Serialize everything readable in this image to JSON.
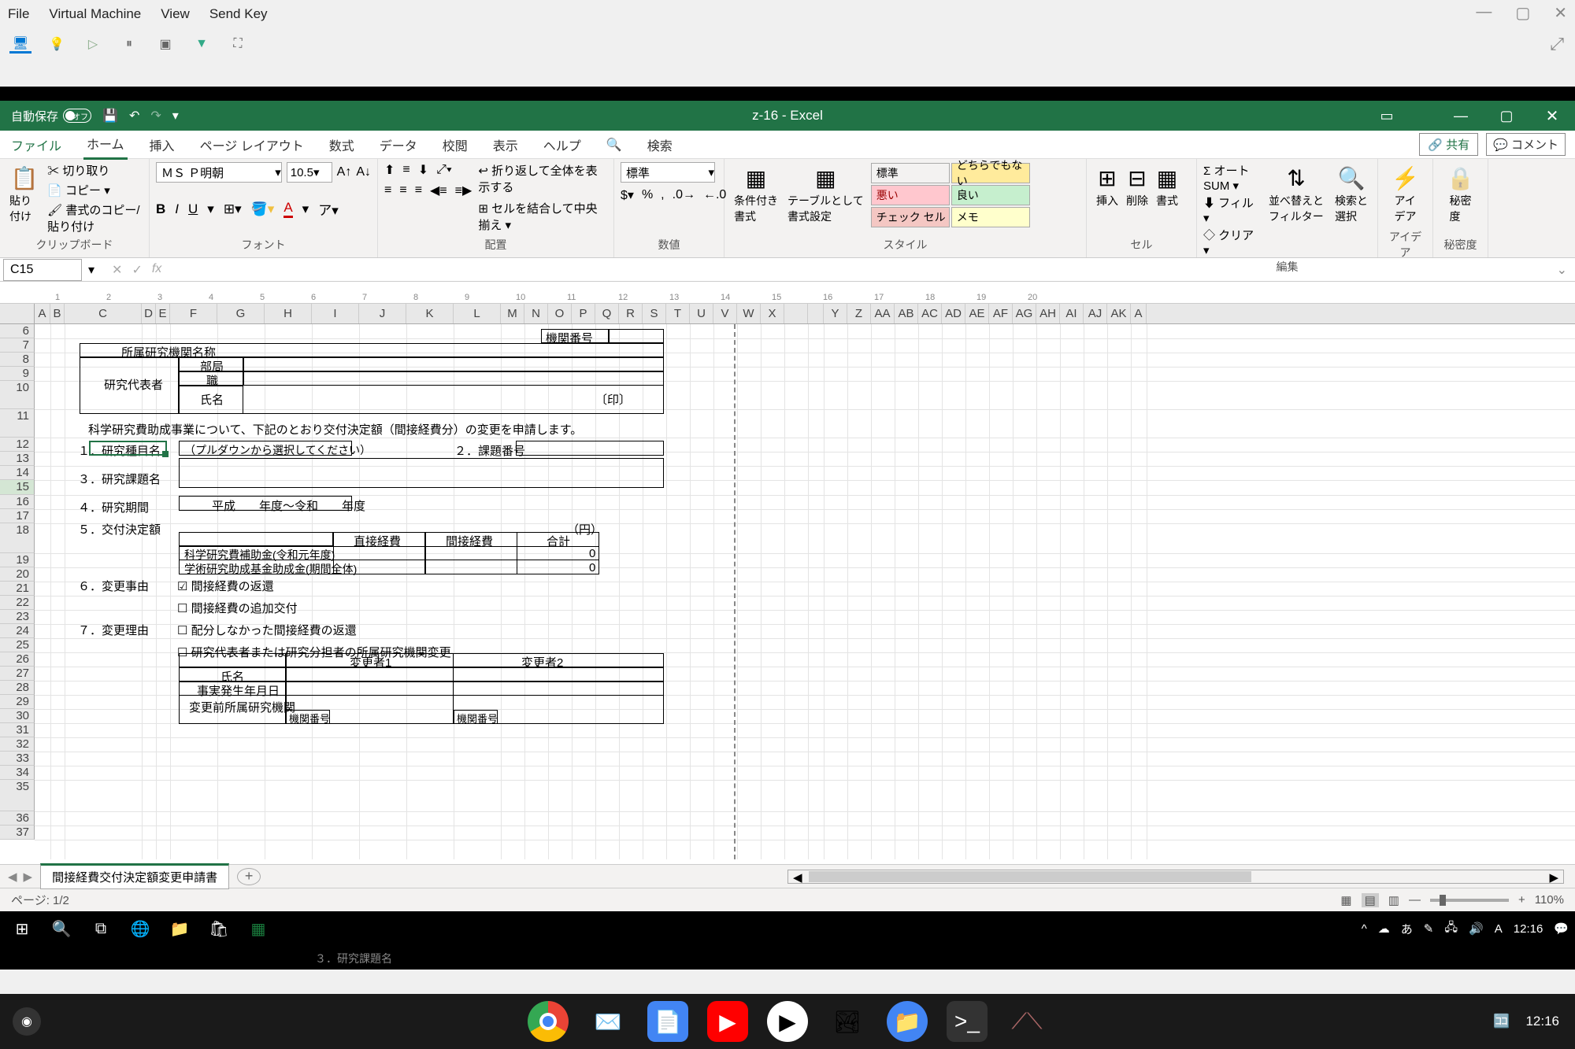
{
  "vm": {
    "menu": [
      "File",
      "Virtual Machine",
      "View",
      "Send Key"
    ]
  },
  "excel": {
    "autosave_label": "自動保存",
    "autosave_state": "オフ",
    "title": "z-16  -  Excel",
    "share": "共有",
    "comment": "コメント",
    "tabs": {
      "file": "ファイル",
      "home": "ホーム",
      "insert": "挿入",
      "page": "ページ レイアウト",
      "formula": "数式",
      "data": "データ",
      "review": "校閲",
      "view": "表示",
      "help": "ヘルプ",
      "search_icon": "",
      "search": "検索"
    },
    "ribbon": {
      "clipboard": {
        "paste": "貼り付け",
        "cut": "切り取り",
        "copy": "コピー",
        "format_painter": "書式のコピー/貼り付け",
        "label": "クリップボード"
      },
      "font": {
        "name": "ＭＳ Ｐ明朝",
        "size": "10.5",
        "label": "フォント"
      },
      "align": {
        "wrap": "折り返して全体を表示する",
        "merge": "セルを結合して中央揃え",
        "label": "配置"
      },
      "number": {
        "format": "標準",
        "label": "数値"
      },
      "styles": {
        "cond": "条件付き\n書式",
        "table": "テーブルとして\n書式設定",
        "s1": "標準",
        "s2": "どちらでもない",
        "s3": "悪い",
        "s4": "良い",
        "s5": "チェック セル",
        "s6": "メモ",
        "label": "スタイル"
      },
      "cells": {
        "insert": "挿入",
        "delete": "削除",
        "format": "書式",
        "label": "セル"
      },
      "editing": {
        "sum": "オート SUM",
        "fill": "フィル",
        "clear": "クリア",
        "sort": "並べ替えと\nフィルター",
        "find": "検索と\n選択",
        "label": "編集"
      },
      "ideas": {
        "label": "アイデア",
        "btn": "アイ\nデア"
      },
      "sensitivity": {
        "label": "秘密度",
        "btn": "秘密\n度"
      }
    },
    "name_box": "C15",
    "columns": [
      "A",
      "B",
      "C",
      "D",
      "E",
      "F",
      "G",
      "H",
      "I",
      "J",
      "K",
      "L",
      "M",
      "N",
      "O",
      "P",
      "Q",
      "R",
      "S",
      "T",
      "U",
      "V",
      "W",
      "X",
      "",
      "",
      "Y",
      "Z",
      "AA",
      "AB",
      "AC",
      "AD",
      "AE",
      "AF",
      "AG",
      "AH",
      "AI",
      "AJ",
      "AK",
      "A"
    ],
    "rows": [
      6,
      7,
      8,
      9,
      10,
      11,
      12,
      13,
      14,
      15,
      16,
      17,
      18,
      19,
      20,
      21,
      22,
      23,
      24,
      25,
      26,
      27,
      28,
      29,
      30,
      31,
      32,
      33,
      34,
      35,
      36,
      37
    ],
    "ruler_marks": [
      1,
      2,
      3,
      4,
      5,
      6,
      7,
      8,
      9,
      10,
      11,
      12,
      13,
      14,
      15,
      16,
      17,
      18,
      19,
      20
    ]
  },
  "form": {
    "org_number_label": "機関番号",
    "org_name_label": "所属研究機関名称",
    "pi_label": "研究代表者",
    "dept": "部局",
    "title_role": "職",
    "name_label": "氏名",
    "seal": "〔印〕",
    "intro": "科学研究費助成事業について、下記のとおり交付決定額（間接経費分）の変更を申請します。",
    "s1": "１．研究種目名",
    "s1_hint": "（プルダウンから選択してください）",
    "s2": "２．課題番号",
    "s3": "３．研究課題名",
    "s4": "４．研究期間",
    "s4_val": "平成　　年度～令和　　年度",
    "s5": "５．交付決定額",
    "yen": "（円）",
    "direct": "直接経費",
    "indirect": "間接経費",
    "total": "合計",
    "row1": "科学研究費補助金(令和元年度)",
    "row2": "学術研究助成基金助成金(期間全体)",
    "zero": "0",
    "s6": "６．変更事由",
    "c1": "間接経費の返還",
    "c2": "間接経費の追加交付",
    "s7": "７．変更理由",
    "c3": "配分しなかった間接経費の返還",
    "c4": "研究代表者または研究分担者の所属研究機関変更",
    "ch1": "変更者1",
    "ch2": "変更者2",
    "t_name": "氏名",
    "t_date": "事実発生年月日",
    "t_prev_org": "変更前所属研究機関",
    "t_org_num": "機関番号"
  },
  "sheet_tab": "間接経費交付決定額変更申請書",
  "status": {
    "page": "ページ: 1/2",
    "zoom": "110%"
  },
  "taskbar": {
    "ime": "あ",
    "time": "12:16"
  },
  "shelf": {
    "time": "12:16"
  }
}
